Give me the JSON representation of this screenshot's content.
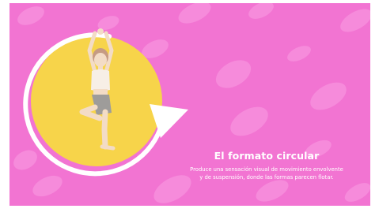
{
  "slide": {
    "title": "El formato circular",
    "description_lines": [
      "Produce una sensación visual de movimiento envolvente",
      "y de suspensión, donde las formas parecen flotar."
    ]
  },
  "illustration": {
    "subject": "yoga-tree-pose-figure",
    "circle_color": "#f7d44a",
    "arrow_color": "#ffffff"
  },
  "colors": {
    "background": "#f274d2",
    "blob": "#f68bdb",
    "text": "#ffffff"
  }
}
